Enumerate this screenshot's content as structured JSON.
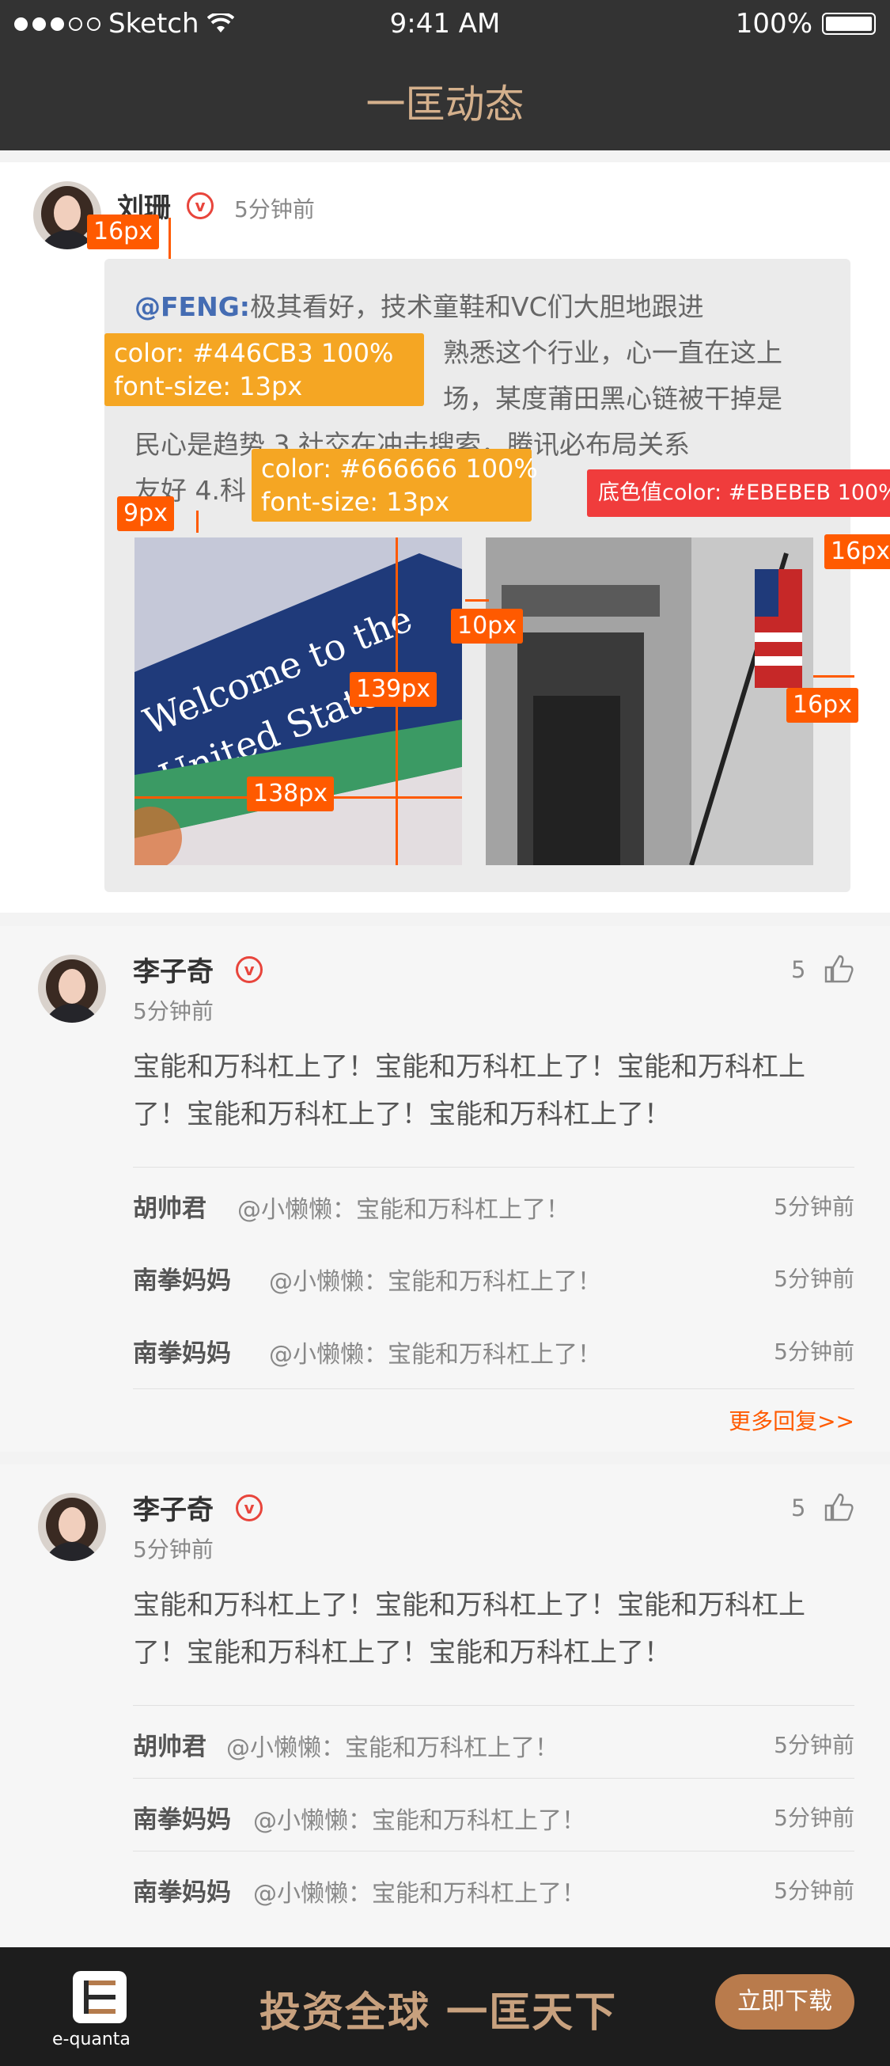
{
  "status_bar": {
    "carrier": "Sketch",
    "time": "9:41 AM",
    "battery": "100%"
  },
  "nav": {
    "title": "一匡动态"
  },
  "post": {
    "author": "刘珊",
    "verified_icon": "v-badge-icon",
    "time": "5分钟前",
    "mention": "@FENG:",
    "text_line1": "极其看好，技术童鞋和VC们大胆地跟进",
    "text_line2": "熟悉这个行业，心一直在这上",
    "text_line3": "场，某度莆田黑心链被干掉是",
    "text_line4": "民心是趋势 3.社交在冲击搜索，腾讯必布局关系",
    "text_line5": "友好 4.科",
    "images": [
      {
        "alt": "Welcome to the United States"
      },
      {
        "alt": "building with flag"
      }
    ]
  },
  "annotations": {
    "a16_1": "16px",
    "a9": "9px",
    "a10": "10px",
    "a139": "139px",
    "a138": "138px",
    "a16_2": "16px",
    "a16_3": "16px",
    "mention_style_1": "color: #446CB3 100%",
    "mention_style_2": "font-size: 13px",
    "body_style_1": "color: #666666 100%",
    "body_style_2": "font-size: 13px",
    "bg_style": "底色值color: #EBEBEB 100%"
  },
  "comments": [
    {
      "author": "李子奇",
      "time": "5分钟前",
      "likes": "5",
      "text_line1": "宝能和万科杠上了！宝能和万科杠上了！宝能和万科杠上",
      "text_line2": "了！宝能和万科杠上了！宝能和万科杠上了！",
      "replies": [
        {
          "name": "胡帅君",
          "text": "@小懒懒：宝能和万科杠上了！",
          "time": "5分钟前"
        },
        {
          "name": "南拳妈妈",
          "text": "@小懒懒：宝能和万科杠上了！",
          "time": "5分钟前"
        },
        {
          "name": "南拳妈妈",
          "text": "@小懒懒：宝能和万科杠上了！",
          "time": "5分钟前"
        }
      ],
      "more": "更多回复>>"
    },
    {
      "author": "李子奇",
      "time": "5分钟前",
      "likes": "5",
      "text_line1": "宝能和万科杠上了！宝能和万科杠上了！宝能和万科杠上",
      "text_line2": "了！宝能和万科杠上了！宝能和万科杠上了！",
      "replies": [
        {
          "name": "胡帅君",
          "text": "@小懒懒：宝能和万科杠上了！",
          "time": "5分钟前"
        },
        {
          "name": "南拳妈妈",
          "text": "@小懒懒：宝能和万科杠上了！",
          "time": "5分钟前"
        },
        {
          "name": "南拳妈妈",
          "text": "@小懒懒：宝能和万科杠上了！",
          "time": "5分钟前"
        }
      ]
    }
  ],
  "bottom_bar": {
    "logo_text": "e-quanta",
    "slogan": "投资全球 一匡天下",
    "download": "立即下载"
  }
}
